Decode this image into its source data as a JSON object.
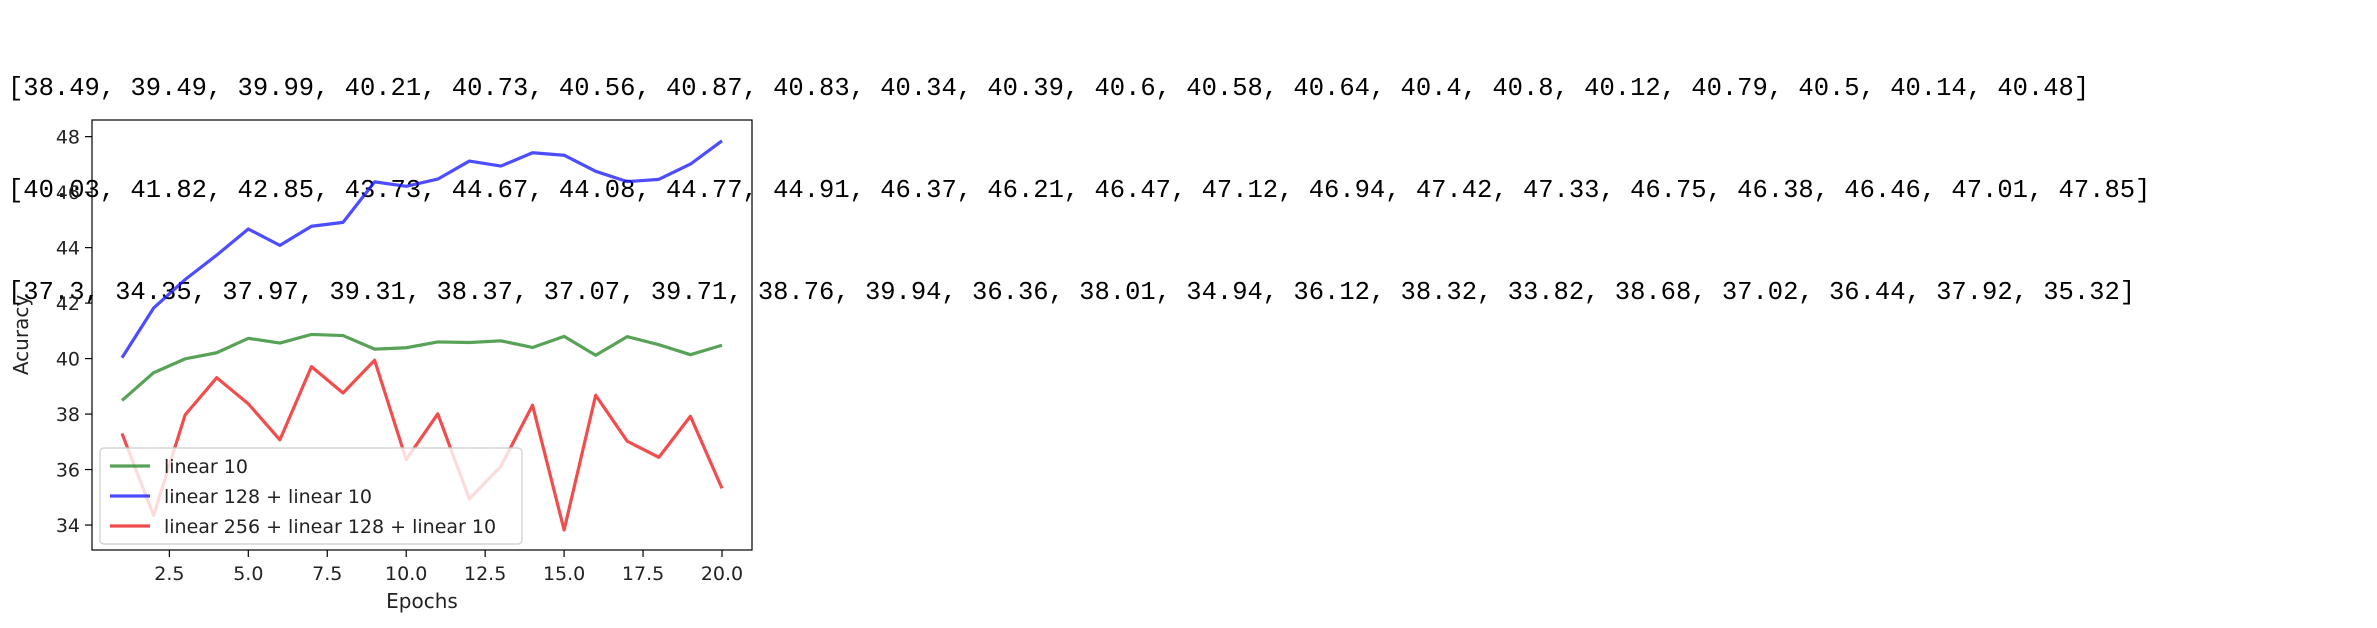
{
  "output": {
    "lines": [
      "[38.49, 39.49, 39.99, 40.21, 40.73, 40.56, 40.87, 40.83, 40.34, 40.39, 40.6, 40.58, 40.64, 40.4, 40.8, 40.12, 40.79, 40.5, 40.14, 40.48]",
      "[40.03, 41.82, 42.85, 43.73, 44.67, 44.08, 44.77, 44.91, 46.37, 46.21, 46.47, 47.12, 46.94, 47.42, 47.33, 46.75, 46.38, 46.46, 47.01, 47.85]",
      "[37.3, 34.35, 37.97, 39.31, 38.37, 37.07, 39.71, 38.76, 39.94, 36.36, 38.01, 34.94, 36.12, 38.32, 33.82, 38.68, 37.02, 36.44, 37.92, 35.32]"
    ]
  },
  "chart_data": {
    "type": "line",
    "title": "",
    "xlabel": "Epochs",
    "ylabel": "Acuracy",
    "x": [
      1,
      2,
      3,
      4,
      5,
      6,
      7,
      8,
      9,
      10,
      11,
      12,
      13,
      14,
      15,
      16,
      17,
      18,
      19,
      20
    ],
    "xlim": [
      0.05,
      20.95
    ],
    "ylim": [
      33.1,
      48.6
    ],
    "xticks": [
      2.5,
      5.0,
      7.5,
      10.0,
      12.5,
      15.0,
      17.5,
      20.0
    ],
    "xtick_labels": [
      "2.5",
      "5.0",
      "7.5",
      "10.0",
      "12.5",
      "15.0",
      "17.5",
      "20.0"
    ],
    "yticks": [
      34,
      36,
      38,
      40,
      42,
      44,
      46,
      48
    ],
    "ytick_labels": [
      "34",
      "36",
      "38",
      "40",
      "42",
      "44",
      "46",
      "48"
    ],
    "grid": false,
    "legend_position": "lower-left",
    "series": [
      {
        "name": "linear 10",
        "color": "#2e8b2e",
        "values": [
          38.49,
          39.49,
          39.99,
          40.21,
          40.73,
          40.56,
          40.87,
          40.83,
          40.34,
          40.39,
          40.6,
          40.58,
          40.64,
          40.4,
          40.8,
          40.12,
          40.79,
          40.5,
          40.14,
          40.48
        ]
      },
      {
        "name": "linear 128 + linear 10",
        "color": "#2020ff",
        "values": [
          40.03,
          41.82,
          42.85,
          43.73,
          44.67,
          44.08,
          44.77,
          44.91,
          46.37,
          46.21,
          46.47,
          47.12,
          46.94,
          47.42,
          47.33,
          46.75,
          46.38,
          46.46,
          47.01,
          47.85
        ]
      },
      {
        "name": "linear 256 + linear 128 + linear 10",
        "color": "#ee2020",
        "values": [
          37.3,
          34.35,
          37.97,
          39.31,
          38.37,
          37.07,
          39.71,
          38.76,
          39.94,
          36.36,
          38.01,
          34.94,
          36.12,
          38.32,
          33.82,
          38.68,
          37.02,
          36.44,
          37.92,
          35.32
        ]
      }
    ]
  }
}
